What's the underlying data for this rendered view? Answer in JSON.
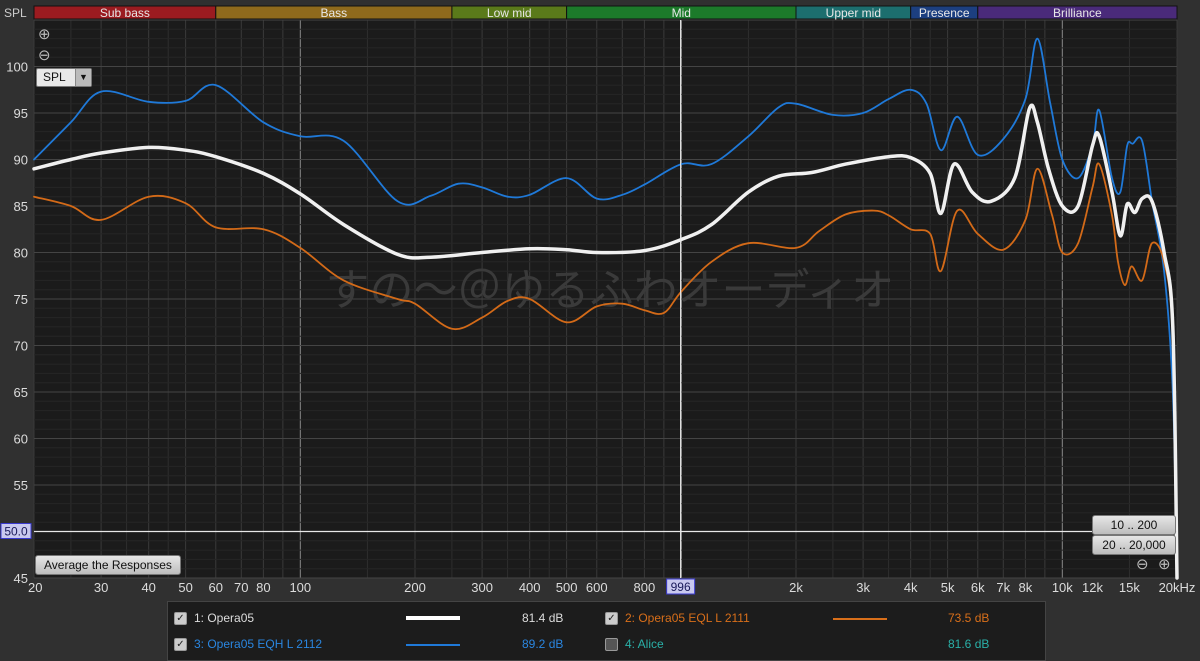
{
  "bands": [
    {
      "label": "Sub bass",
      "from": 20,
      "to": 60,
      "color": "#9b1b20"
    },
    {
      "label": "Bass",
      "from": 60,
      "to": 250,
      "color": "#8f6a1c"
    },
    {
      "label": "Low mid",
      "from": 250,
      "to": 500,
      "color": "#5a7a1a"
    },
    {
      "label": "Mid",
      "from": 500,
      "to": 2000,
      "color": "#1c7a2a"
    },
    {
      "label": "Upper mid",
      "from": 2000,
      "to": 4000,
      "color": "#1c6e6e"
    },
    {
      "label": "Presence",
      "from": 4000,
      "to": 6000,
      "color": "#1c3f80"
    },
    {
      "label": "Brilliance",
      "from": 6000,
      "to": 20000,
      "color": "#4a2a7a"
    }
  ],
  "ui": {
    "axis_label": "SPL",
    "spl_dropdown": "SPL",
    "zoom_in": "⊕",
    "zoom_out": "⊖",
    "cursor_level": "50.0",
    "cursor_freq": "996",
    "average_button": "Average the Responses",
    "range_button_1": "10 .. 200",
    "range_button_2": "20 .. 20,000",
    "watermark": "すの〜＠ゆるふわオーディオ"
  },
  "legend": [
    {
      "id": "1",
      "name": "1: Opera05",
      "value": "81.4 dB",
      "color": "#ffffff",
      "name_color": "#dddddd",
      "value_color": "#dddddd",
      "checked": true
    },
    {
      "id": "2",
      "name": "2: Opera05 EQL L 2111",
      "value": "73.5 dB",
      "color": "#d96f1a",
      "name_color": "#d96f1a",
      "value_color": "#d96f1a",
      "checked": true
    },
    {
      "id": "3",
      "name": "3: Opera05 EQH L 2112",
      "value": "89.2 dB",
      "color": "#1f79d8",
      "name_color": "#2a86e0",
      "value_color": "#2a86e0",
      "checked": true
    },
    {
      "id": "4",
      "name": "4: Alice",
      "value": "81.6 dB",
      "color": "#2ab0a8",
      "name_color": "#2ab0a8",
      "value_color": "#2ab0a8",
      "checked": false
    }
  ],
  "chart_data": {
    "type": "line",
    "xscale": "log",
    "xlim": [
      20,
      20000
    ],
    "ylim": [
      45,
      105
    ],
    "xticks": [
      {
        "v": 20,
        "l": "20"
      },
      {
        "v": 30,
        "l": "30"
      },
      {
        "v": 40,
        "l": "40"
      },
      {
        "v": 50,
        "l": "50"
      },
      {
        "v": 60,
        "l": "60"
      },
      {
        "v": 70,
        "l": "70"
      },
      {
        "v": 80,
        "l": "80"
      },
      {
        "v": 100,
        "l": "100"
      },
      {
        "v": 200,
        "l": "200"
      },
      {
        "v": 300,
        "l": "300"
      },
      {
        "v": 400,
        "l": "400"
      },
      {
        "v": 500,
        "l": "500"
      },
      {
        "v": 600,
        "l": "600"
      },
      {
        "v": 800,
        "l": "800"
      },
      {
        "v": 2000,
        "l": "2k"
      },
      {
        "v": 3000,
        "l": "3k"
      },
      {
        "v": 4000,
        "l": "4k"
      },
      {
        "v": 5000,
        "l": "5k"
      },
      {
        "v": 6000,
        "l": "6k"
      },
      {
        "v": 7000,
        "l": "7k"
      },
      {
        "v": 8000,
        "l": "8k"
      },
      {
        "v": 10000,
        "l": "10k"
      },
      {
        "v": 12000,
        "l": "12k"
      },
      {
        "v": 15000,
        "l": "15k"
      },
      {
        "v": 20000,
        "l": "20kHz"
      }
    ],
    "yticks": [
      45,
      50,
      55,
      60,
      65,
      70,
      75,
      80,
      85,
      90,
      95,
      100
    ],
    "series": [
      {
        "name": "1: Opera05",
        "color": "#f0f0f0",
        "width": 3.5,
        "x": [
          20,
          25,
          30,
          40,
          50,
          60,
          80,
          100,
          130,
          180,
          220,
          300,
          400,
          500,
          600,
          800,
          1000,
          1200,
          1500,
          1800,
          2200,
          2700,
          3500,
          4000,
          4500,
          4800,
          5200,
          5800,
          6500,
          7500,
          8200,
          8600,
          9200,
          10000,
          11000,
          12000,
          12500,
          13500,
          14200,
          14800,
          15500,
          16200,
          17200,
          18500,
          19500,
          20000
        ],
        "y": [
          89,
          90,
          90.7,
          91.3,
          91,
          90.3,
          88.5,
          86.3,
          83,
          79.8,
          79.5,
          80,
          80.4,
          80.3,
          80,
          80.2,
          81.4,
          83,
          86.5,
          88.2,
          88.6,
          89.5,
          90.3,
          90.2,
          88.5,
          84.2,
          89.5,
          86.5,
          85.5,
          88,
          95.5,
          94,
          89,
          85,
          85,
          91.5,
          92.5,
          86.5,
          81.8,
          85.2,
          84.3,
          85.8,
          85.5,
          80,
          72,
          45
        ]
      },
      {
        "name": "2: Opera05 EQL L 2111",
        "color": "#d36a18",
        "width": 1.8,
        "x": [
          20,
          25,
          30,
          40,
          50,
          60,
          80,
          100,
          130,
          180,
          200,
          250,
          300,
          350,
          400,
          500,
          600,
          700,
          800,
          900,
          1000,
          1200,
          1500,
          2000,
          2300,
          2700,
          3200,
          3500,
          4000,
          4500,
          4800,
          5300,
          6000,
          7000,
          8000,
          8600,
          9400,
          10000,
          11000,
          12000,
          12500,
          13500,
          14000,
          14600,
          15200,
          16200,
          17200,
          18500,
          19500,
          20000
        ],
        "y": [
          86,
          85,
          83.5,
          86,
          85.3,
          82.7,
          82.5,
          80.5,
          77,
          75,
          74.5,
          71.8,
          73,
          74.8,
          75,
          72.5,
          74.2,
          74.5,
          73.8,
          73.5,
          75.8,
          79,
          81,
          80.5,
          82.3,
          84.1,
          84.5,
          84,
          82.5,
          82,
          78,
          84.5,
          82,
          80.3,
          83.5,
          89,
          84,
          80,
          81,
          87,
          89.5,
          84,
          79,
          76.5,
          78.5,
          77,
          81,
          79,
          71,
          45
        ]
      },
      {
        "name": "3: Opera05 EQH L 2112",
        "color": "#1f79d8",
        "width": 1.8,
        "x": [
          20,
          25,
          30,
          40,
          50,
          60,
          80,
          100,
          130,
          180,
          220,
          260,
          300,
          350,
          400,
          500,
          600,
          700,
          800,
          1000,
          1200,
          1500,
          1800,
          2000,
          2500,
          3000,
          3500,
          4000,
          4400,
          4800,
          5300,
          6000,
          7000,
          8000,
          8600,
          9300,
          10000,
          11000,
          12000,
          12500,
          13500,
          14200,
          14800,
          15300,
          16200,
          17200,
          18500,
          19500,
          20000
        ],
        "y": [
          90,
          94,
          97.3,
          96.2,
          96.3,
          98,
          94,
          92.5,
          92,
          85.5,
          86.1,
          87.4,
          87,
          86,
          86.2,
          88,
          85.8,
          86.2,
          87.3,
          89.5,
          89.5,
          92.5,
          95.6,
          96,
          94.8,
          95,
          96.5,
          97.5,
          96,
          91,
          94.6,
          90.5,
          92.2,
          96.5,
          103,
          96,
          90,
          88,
          91.5,
          95.3,
          88,
          86.5,
          91.5,
          91.7,
          92,
          85.5,
          78,
          65,
          45
        ]
      }
    ]
  }
}
